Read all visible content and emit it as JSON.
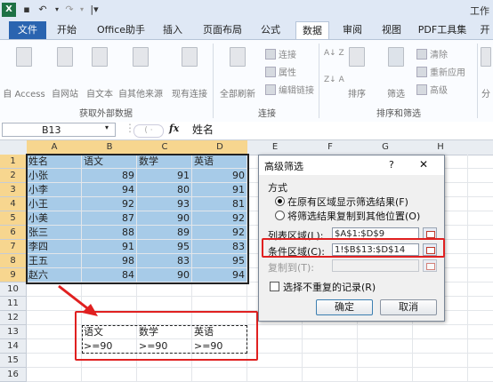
{
  "titlebar": {
    "title": "工作"
  },
  "tabs": [
    "文件",
    "开始",
    "Office助手",
    "插入",
    "页面布局",
    "公式",
    "数据",
    "审阅",
    "视图",
    "PDF工具集",
    "开"
  ],
  "ribbon": {
    "groups": [
      {
        "label": "获取外部数据",
        "buttons": [
          "自 Access",
          "自网站",
          "自文本",
          "自其他来源",
          "现有连接"
        ]
      },
      {
        "label": "连接",
        "buttons": [
          "全部刷新"
        ],
        "small": [
          "连接",
          "属性",
          "编辑链接"
        ]
      },
      {
        "label": "排序和筛选",
        "buttons": [
          "排序",
          "筛选"
        ],
        "small": [
          "清除",
          "重新应用",
          "高级"
        ]
      },
      {
        "label": "",
        "buttons": [
          "分"
        ]
      }
    ],
    "sort_az": "A↓ Z",
    "sort_za": "Z↓ A"
  },
  "formula_bar": {
    "name_box": "B13",
    "fx": "fx",
    "value": "姓名"
  },
  "columns": [
    "A",
    "B",
    "C",
    "D",
    "E",
    "F",
    "G",
    "H"
  ],
  "rows": [
    "1",
    "2",
    "3",
    "4",
    "5",
    "6",
    "7",
    "8",
    "9",
    "10",
    "11",
    "12",
    "13",
    "14",
    "15",
    "16"
  ],
  "table": {
    "headers": [
      "姓名",
      "语文",
      "数学",
      "英语"
    ],
    "rows": [
      [
        "小张",
        "89",
        "91",
        "90"
      ],
      [
        "小李",
        "94",
        "80",
        "91"
      ],
      [
        "小王",
        "92",
        "93",
        "81"
      ],
      [
        "小美",
        "87",
        "90",
        "92"
      ],
      [
        "张三",
        "88",
        "89",
        "92"
      ],
      [
        "李四",
        "91",
        "95",
        "83"
      ],
      [
        "王五",
        "98",
        "83",
        "95"
      ],
      [
        "赵六",
        "84",
        "90",
        "94"
      ]
    ]
  },
  "criteria": {
    "headers": [
      "语文",
      "数学",
      "英语"
    ],
    "values": [
      ">=90",
      ">=90",
      ">=90"
    ]
  },
  "dialog": {
    "title": "高级筛选",
    "help": "?",
    "close": "✕",
    "section": "方式",
    "option1": "在原有区域显示筛选结果(F)",
    "option2": "将筛选结果复制到其他位置(O)",
    "list_label": "列表区域(L):",
    "list_value": "$A$1:$D$9",
    "criteria_label": "条件区域(C):",
    "criteria_value": "1!$B$13:$D$14",
    "copy_label": "复制到(T):",
    "copy_value": "",
    "unique_label": "选择不重复的记录(R)",
    "ok": "确定",
    "cancel": "取消"
  },
  "colors": {
    "accent": "#2a64b0",
    "selection": "#a7cbe8",
    "highlight": "#e02020"
  }
}
